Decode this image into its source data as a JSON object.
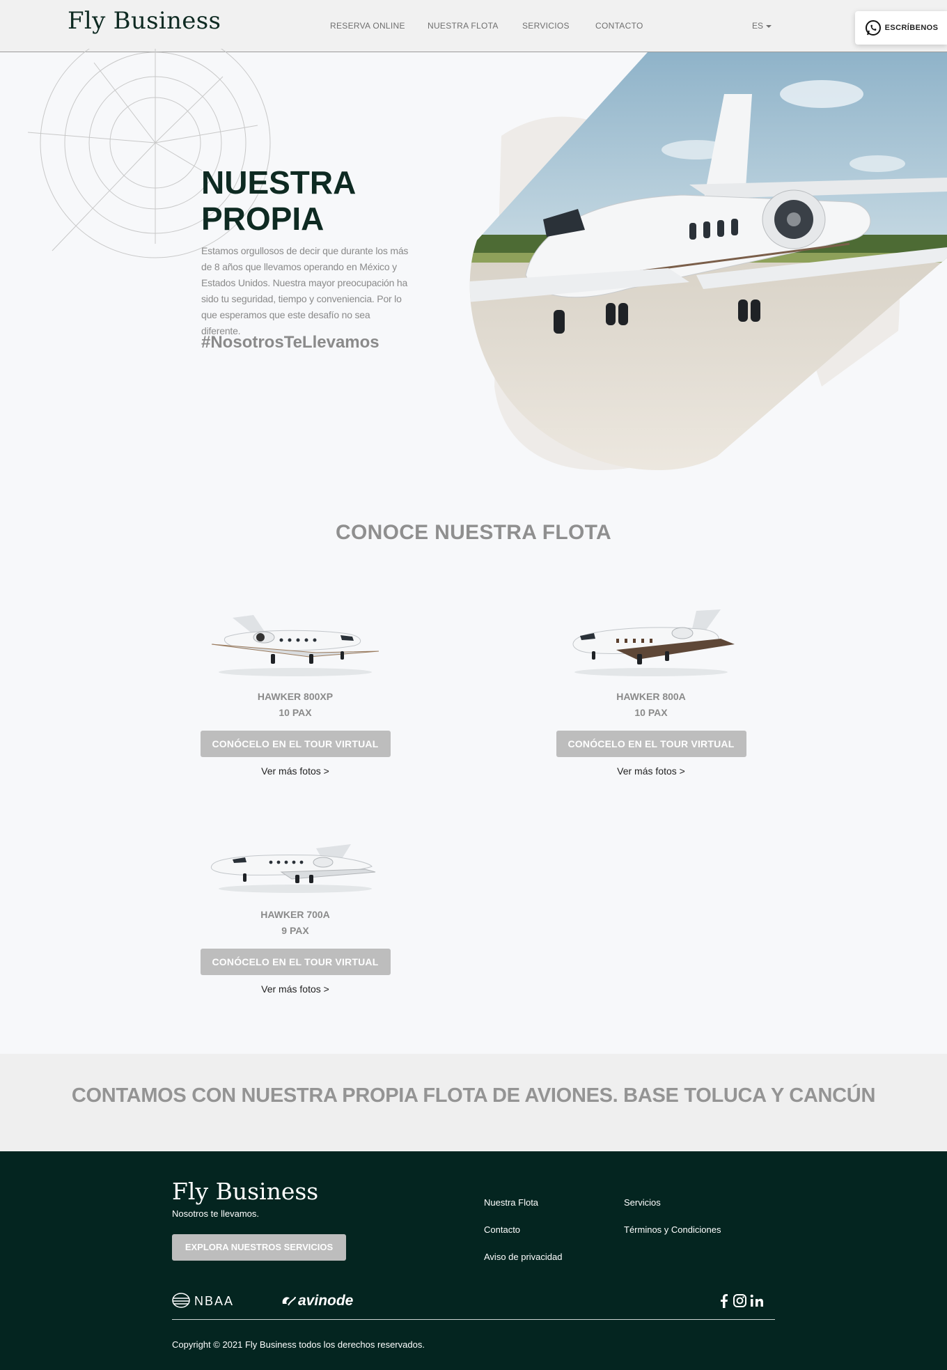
{
  "header": {
    "brand": "Fly Business",
    "nav": [
      {
        "label": "RESERVA ONLINE"
      },
      {
        "label": "NUESTRA FLOTA"
      },
      {
        "label": "SERVICIOS"
      },
      {
        "label": "CONTACTO"
      }
    ],
    "language": "ES",
    "whatsapp_label": "ESCRÍBENOS"
  },
  "hero": {
    "title": "NUESTRA PROPIA",
    "text": "Estamos orgullosos de decir que durante los más de 8 años que llevamos operando en México y Estados Unidos. Nuestra mayor preocupación ha sido tu seguridad, tiempo y conveniencia. Por lo que esperamos que este desafío no sea diferente.",
    "hashtag": "#NosotrosTeLlevamos"
  },
  "fleet": {
    "title": "CONOCE NUESTRA FLOTA",
    "items": [
      {
        "model": "HAWKER 800XP",
        "pax": "10 PAX",
        "tour_label": "CONÓCELO EN EL TOUR VIRTUAL",
        "photos_label": "Ver más fotos >"
      },
      {
        "model": "HAWKER 800A",
        "pax": "10 PAX",
        "tour_label": "CONÓCELO EN EL TOUR VIRTUAL",
        "photos_label": "Ver más fotos >"
      },
      {
        "model": "HAWKER 700A",
        "pax": "9 PAX",
        "tour_label": "CONÓCELO EN EL TOUR VIRTUAL",
        "photos_label": "Ver más fotos >"
      }
    ]
  },
  "banner": {
    "text": "CONTAMOS CON NUESTRA PROPIA FLOTA DE AVIONES. BASE TOLUCA Y CANCÚN"
  },
  "footer": {
    "brand": "Fly Business",
    "tagline": "Nosotros te llevamos.",
    "cta_label": "EXPLORA NUESTROS SERVICIOS",
    "links": {
      "nuestra_flota": "Nuestra Flota",
      "servicios": "Servicios",
      "contacto": "Contacto",
      "terminos": "Términos y Condiciones",
      "privacidad": "Aviso de privacidad"
    },
    "partners": {
      "nbaa": "NBAA",
      "avinode": "avinode"
    },
    "social_icons": [
      "facebook-icon",
      "instagram-icon",
      "linkedin-icon"
    ],
    "copyright": "Copyright © 2021 Fly Business todos los derechos reservados."
  },
  "colors": {
    "brand_dark_green": "#042520",
    "button_gray": "#bdbdbd",
    "page_bg": "#f7f8fa"
  }
}
